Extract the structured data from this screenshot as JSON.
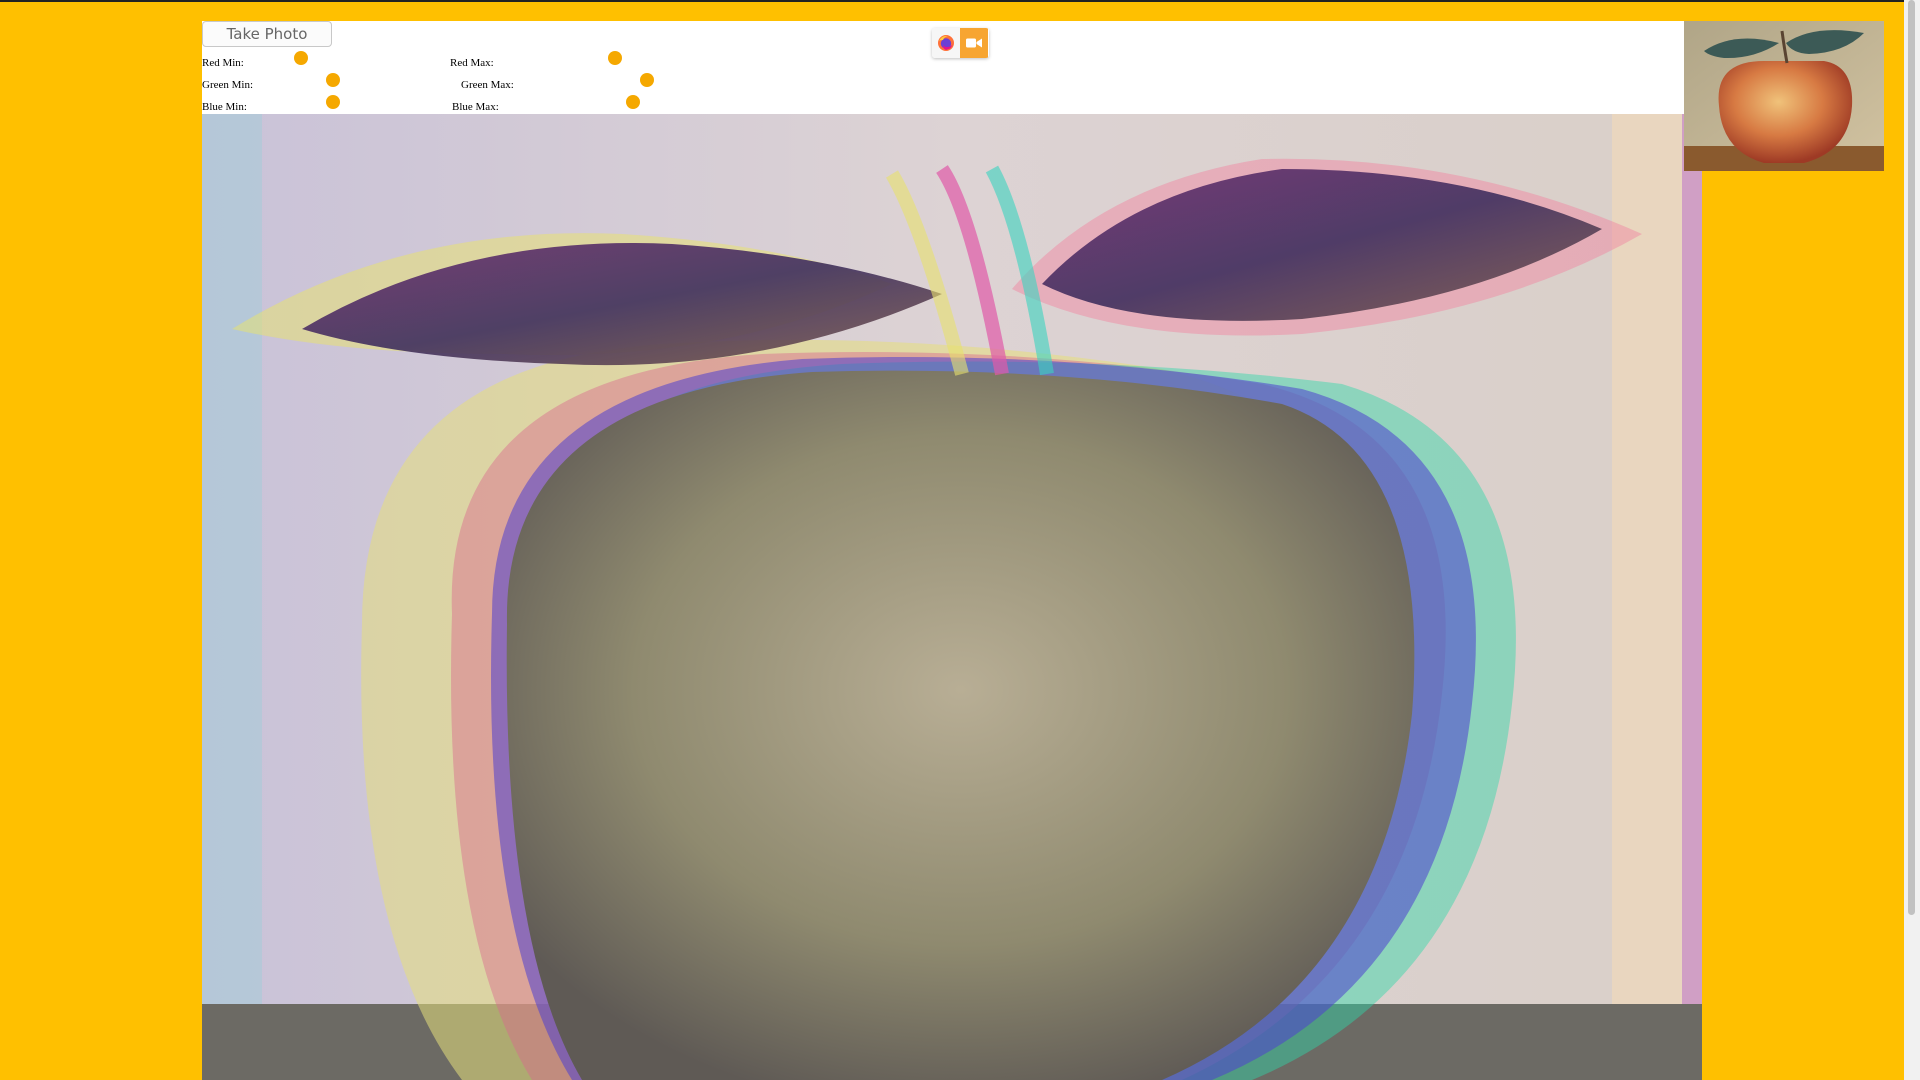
{
  "toolbar": {
    "take_photo_label": "Take Photo",
    "icons": [
      "firefox-icon",
      "camera-icon"
    ]
  },
  "sliders": [
    {
      "label": "Red Min:",
      "value_fraction": 0.38
    },
    {
      "label": "Red Max:",
      "value_fraction": 0.86
    },
    {
      "label": "Green Min:",
      "value_fraction": 0.55
    },
    {
      "label": "Green Max:",
      "value_fraction": 0.97
    },
    {
      "label": "Blue Min:",
      "value_fraction": 0.55
    },
    {
      "label": "Blue Max:",
      "value_fraction": 0.94
    }
  ],
  "colors": {
    "page_background": "#ffc000",
    "slider_thumb": "#f5a800",
    "camera_button": "#f7a531"
  },
  "images": {
    "main": "apple-painting-rgb-shifted",
    "preview": "apple-painting-original"
  }
}
